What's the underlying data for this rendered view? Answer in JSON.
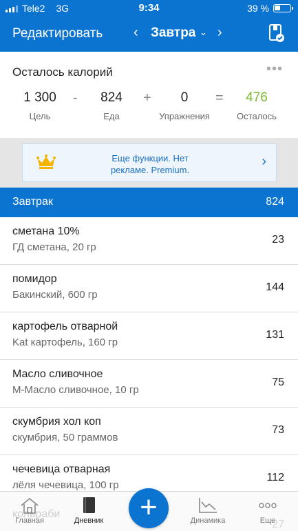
{
  "status_bar": {
    "carrier": "Tele2",
    "network": "3G",
    "time": "9:34",
    "battery_text": "39 %",
    "battery_level": 0.39
  },
  "nav": {
    "edit_label": "Редактировать",
    "prev": "‹",
    "day": "Завтра",
    "caret": "⌄",
    "next": "›"
  },
  "summary": {
    "title": "Осталось калорий",
    "more": "•••",
    "goal": {
      "value": "1 300",
      "label": "Цель"
    },
    "minus": "-",
    "food": {
      "value": "824",
      "label": "Еда"
    },
    "plus": "+",
    "exercise": {
      "value": "0",
      "label": "Упражнения"
    },
    "equals": "=",
    "remaining": {
      "value": "476",
      "label": "Осталось"
    }
  },
  "promo": {
    "line1": "Еще функции. Нет",
    "line2": "рекламе. Premium.",
    "chevron": "›"
  },
  "meal": {
    "name": "Завтрак",
    "calories": "824",
    "items": [
      {
        "name": "сметана 10%",
        "desc": "ГД сметана, 20 гр",
        "calories": "23"
      },
      {
        "name": "помидор",
        "desc": "Бакинский, 600 гр",
        "calories": "144"
      },
      {
        "name": "картофель отварной",
        "desc": "Kat картофель, 160 гр",
        "calories": "131"
      },
      {
        "name": "Масло сливочное",
        "desc": "М-Масло сливочное, 10 гр",
        "calories": "75"
      },
      {
        "name": "скумбрия хол коп",
        "desc": "скумбрия, 50 граммов",
        "calories": "73"
      },
      {
        "name": "чечевица отварная",
        "desc": "лёля чечевица, 100 гр",
        "calories": "112"
      }
    ],
    "partial_item_name": "кольраби",
    "partial_item_calories": "27"
  },
  "tabbar": {
    "home": "Главная",
    "diary": "Дневник",
    "add": "+",
    "progress": "Динамика",
    "more": "Еще"
  },
  "colors": {
    "brand_blue": "#0b74d1",
    "remaining_green": "#7cb82f",
    "crown_gold": "#f5b400"
  }
}
